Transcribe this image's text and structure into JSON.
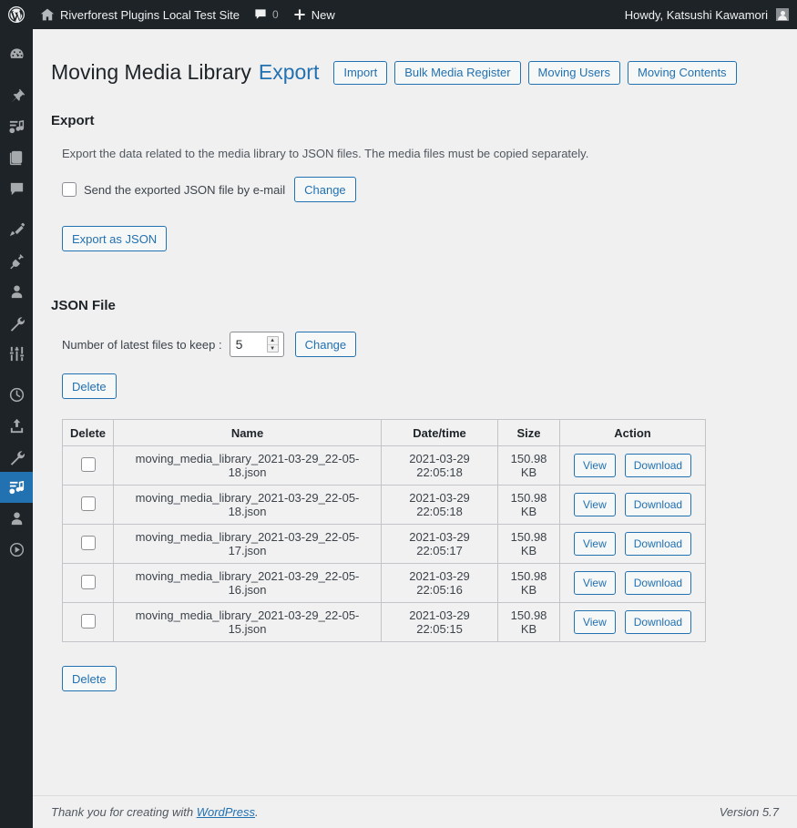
{
  "adminbar": {
    "wp_logo": "wordpress-logo-icon",
    "site_name": "Riverforest Plugins Local Test Site",
    "comments_icon": "comment-bubble-icon",
    "comments_count": "0",
    "new_icon": "plus-icon",
    "new_label": "New",
    "howdy": "Howdy, Katsushi Kawamori",
    "avatar": "user-avatar"
  },
  "sidebar": {
    "active_index": 12,
    "items": [
      {
        "icon": "dashboard-icon",
        "name": "sidebar-item-dashboard"
      },
      {
        "icon": "pin-icon",
        "name": "sidebar-item-posts"
      },
      {
        "icon": "media-icon",
        "name": "sidebar-item-media"
      },
      {
        "icon": "pages-icon",
        "name": "sidebar-item-pages"
      },
      {
        "icon": "comment-icon",
        "name": "sidebar-item-comments"
      },
      {
        "icon": "brush-icon",
        "name": "sidebar-item-appearance"
      },
      {
        "icon": "plug-icon",
        "name": "sidebar-item-plugins"
      },
      {
        "icon": "user-icon",
        "name": "sidebar-item-users"
      },
      {
        "icon": "wrench-icon",
        "name": "sidebar-item-tools"
      },
      {
        "icon": "settings-sliders-icon",
        "name": "sidebar-item-settings"
      },
      {
        "icon": "clock-icon",
        "name": "sidebar-item-scheduled"
      },
      {
        "icon": "upload-icon",
        "name": "sidebar-item-upload"
      },
      {
        "icon": "wrench-icon",
        "name": "sidebar-item-plugin-tools"
      },
      {
        "icon": "media-icon",
        "name": "sidebar-item-moving-media-library"
      },
      {
        "icon": "user-icon",
        "name": "sidebar-item-moving-users"
      },
      {
        "icon": "play-icon",
        "name": "sidebar-item-media-player"
      }
    ]
  },
  "header": {
    "title": "Moving Media Library",
    "accent": "Export",
    "nav_buttons": [
      {
        "label": "Import",
        "name": "import-button"
      },
      {
        "label": "Bulk Media Register",
        "name": "bulk-media-register-button"
      },
      {
        "label": "Moving Users",
        "name": "moving-users-button"
      },
      {
        "label": "Moving Contents",
        "name": "moving-contents-button"
      }
    ]
  },
  "export": {
    "section_title": "Export",
    "description": "Export the data related to the media library to JSON files. The media files must be copied separately.",
    "email_checkbox_label": "Send the exported JSON file by e-mail",
    "email_checked": false,
    "change_label": "Change",
    "export_button_label": "Export as JSON"
  },
  "json_file": {
    "section_title": "JSON File",
    "keep_label": "Number of latest files to keep :",
    "keep_value": "5",
    "change_label": "Change",
    "delete_top_label": "Delete",
    "delete_bottom_label": "Delete",
    "columns": [
      "Delete",
      "Name",
      "Date/time",
      "Size",
      "Action"
    ],
    "view_label": "View",
    "download_label": "Download",
    "rows": [
      {
        "checked": false,
        "name": "moving_media_library_2021-03-29_22-05-18.json",
        "datetime": "2021-03-29 22:05:18",
        "size": "150.98 KB"
      },
      {
        "checked": false,
        "name": "moving_media_library_2021-03-29_22-05-18.json",
        "datetime": "2021-03-29 22:05:18",
        "size": "150.98 KB"
      },
      {
        "checked": false,
        "name": "moving_media_library_2021-03-29_22-05-17.json",
        "datetime": "2021-03-29 22:05:17",
        "size": "150.98 KB"
      },
      {
        "checked": false,
        "name": "moving_media_library_2021-03-29_22-05-16.json",
        "datetime": "2021-03-29 22:05:16",
        "size": "150.98 KB"
      },
      {
        "checked": false,
        "name": "moving_media_library_2021-03-29_22-05-15.json",
        "datetime": "2021-03-29 22:05:15",
        "size": "150.98 KB"
      }
    ]
  },
  "footer": {
    "thanks_prefix": "Thank you for creating with ",
    "wordpress_link": "WordPress",
    "thanks_suffix": ".",
    "version": "Version 5.7"
  },
  "colors": {
    "adminbar_bg": "#1d2327",
    "sidebar_bg": "#1d2327",
    "accent_blue": "#2271b1",
    "content_bg": "#f0f0f1",
    "active_menu_bg": "#2271b1"
  }
}
